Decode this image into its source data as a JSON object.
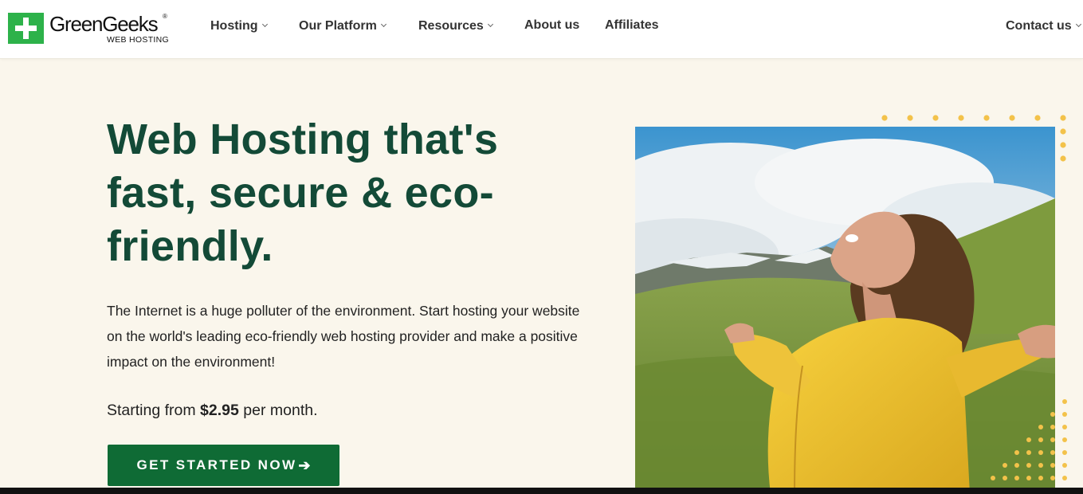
{
  "brand": {
    "name": "GreenGeeks",
    "registered_mark": "®",
    "tagline": "WEB HOSTING",
    "color": "#2db24a"
  },
  "nav": {
    "items": [
      {
        "label": "Hosting",
        "has_dropdown": true
      },
      {
        "label": "Our Platform",
        "has_dropdown": true
      },
      {
        "label": "Resources",
        "has_dropdown": true
      },
      {
        "label": "About us",
        "has_dropdown": false
      },
      {
        "label": "Affiliates",
        "has_dropdown": false
      }
    ],
    "contact": {
      "label": "Contact us",
      "has_dropdown": true
    }
  },
  "hero": {
    "title": "Web Hosting that's fast, secure & eco-friendly.",
    "description": "The Internet is a huge polluter of the environment. Start hosting your website on the world's leading eco-friendly web hosting provider and make a positive impact on the environment!",
    "price_prefix": "Starting from",
    "price": "$2.95",
    "price_suffix": "per month.",
    "cta_label": "GET STARTED NOW",
    "cta_icon": "arrow-right-icon"
  },
  "colors": {
    "title": "#134a37",
    "cta": "#0f6b35",
    "background": "#faf6ec",
    "dots": "#f3c24a"
  }
}
